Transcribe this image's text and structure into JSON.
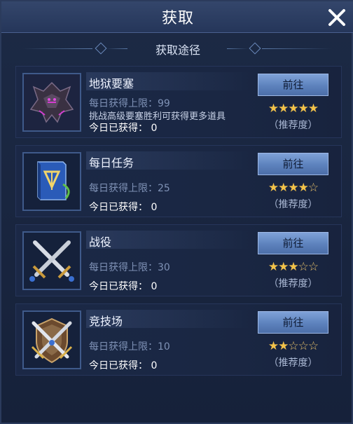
{
  "header": {
    "title": "获取",
    "close_icon": "close-icon"
  },
  "subtitle": "获取途径",
  "colors": {
    "star": "#f2c24a",
    "button": "#6a8dc8",
    "background": "#16213a"
  },
  "routes": [
    {
      "name": "地狱要塞",
      "limit": "每日获得上限：99",
      "extra": "挑战高级要塞胜利可获得更多道具",
      "today": "今日已获得：  0",
      "button": "前往",
      "stars_full": 5,
      "stars_total": 5,
      "recommend": "（推荐度）",
      "icon": "dragon-icon"
    },
    {
      "name": "每日任务",
      "limit": "每日获得上限：25",
      "extra": "",
      "today": "今日已获得：  0",
      "button": "前往",
      "stars_full": 4,
      "stars_total": 5,
      "recommend": "（推荐度）",
      "icon": "book-icon"
    },
    {
      "name": "战役",
      "limit": "每日获得上限：30",
      "extra": "",
      "today": "今日已获得：  0",
      "button": "前往",
      "stars_full": 3,
      "stars_total": 5,
      "recommend": "（推荐度）",
      "icon": "crossed-swords-icon"
    },
    {
      "name": "竞技场",
      "limit": "每日获得上限：10",
      "extra": "",
      "today": "今日已获得：  0",
      "button": "前往",
      "stars_full": 2,
      "stars_total": 5,
      "recommend": "（推荐度）",
      "icon": "shield-swords-icon"
    }
  ]
}
